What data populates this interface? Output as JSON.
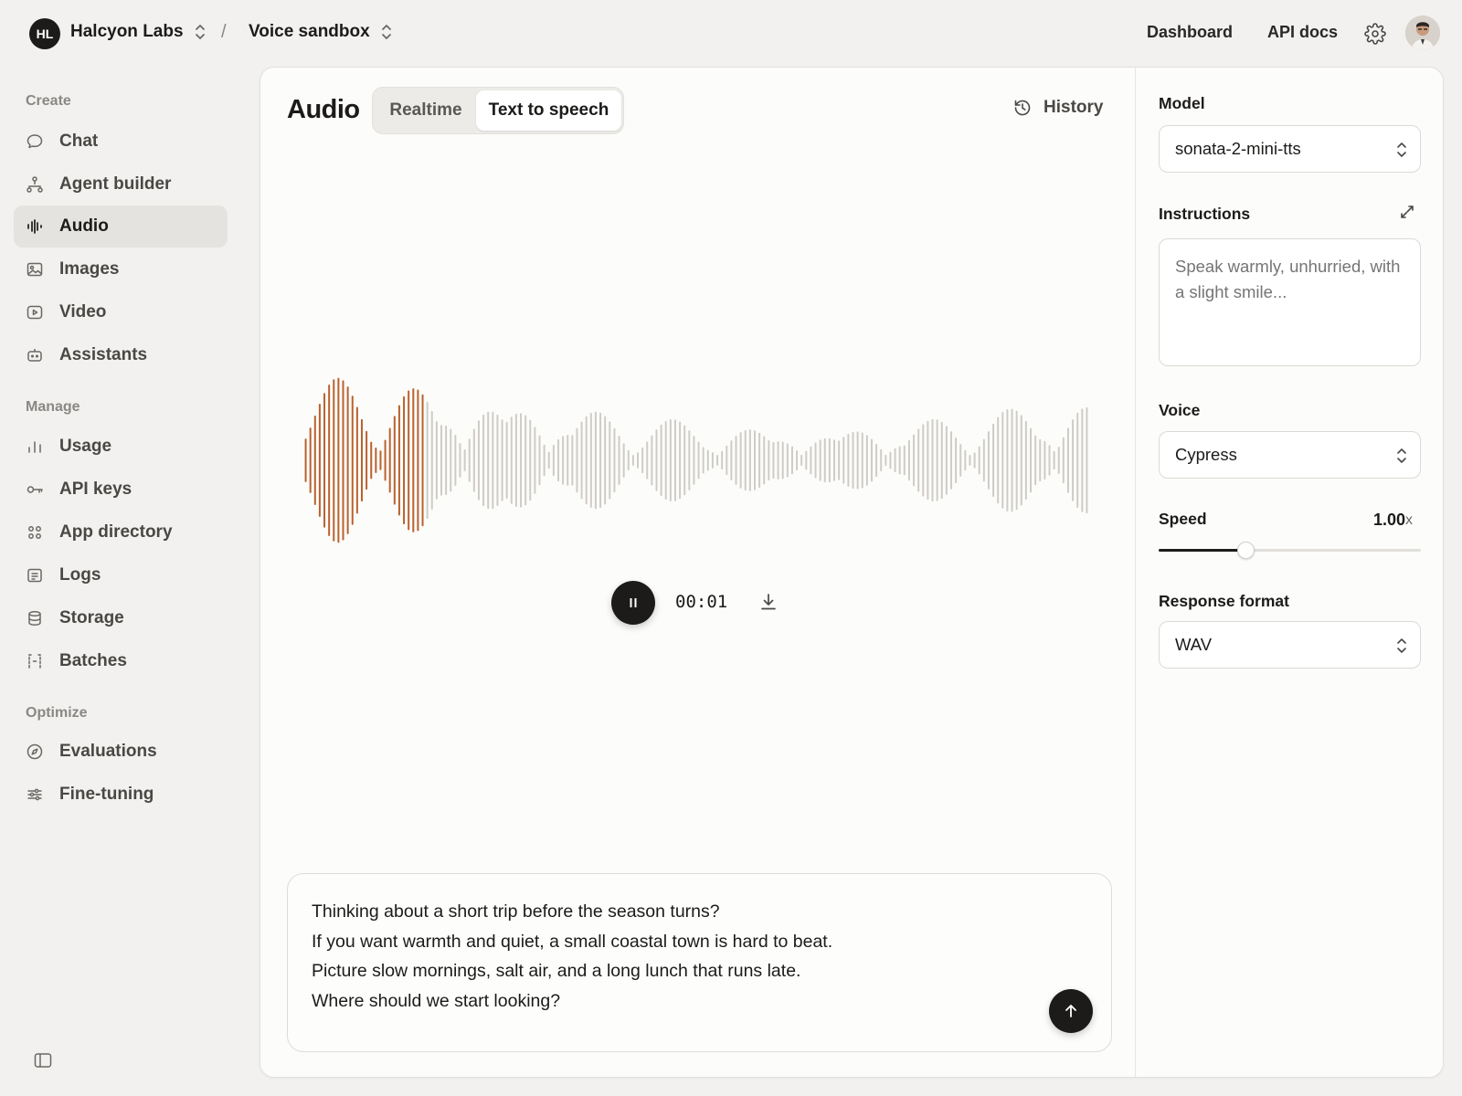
{
  "topbar": {
    "org_initials": "HL",
    "org_name": "Halcyon Labs",
    "project_name": "Voice sandbox",
    "separator": "/",
    "links": [
      "Dashboard",
      "API docs"
    ]
  },
  "sidebar": {
    "sections": [
      {
        "label": "Create",
        "items": [
          {
            "label": "Chat",
            "icon": "chat-bubble-icon"
          },
          {
            "label": "Agent builder",
            "icon": "agent-tree-icon"
          },
          {
            "label": "Audio",
            "icon": "audio-wave-icon",
            "active": true
          },
          {
            "label": "Images",
            "icon": "image-icon"
          },
          {
            "label": "Video",
            "icon": "video-play-icon"
          },
          {
            "label": "Assistants",
            "icon": "robot-icon"
          }
        ]
      },
      {
        "label": "Manage",
        "items": [
          {
            "label": "Usage",
            "icon": "bar-chart-icon"
          },
          {
            "label": "API keys",
            "icon": "key-icon"
          },
          {
            "label": "App directory",
            "icon": "grid-dots-icon"
          },
          {
            "label": "Logs",
            "icon": "log-list-icon"
          },
          {
            "label": "Storage",
            "icon": "database-icon"
          },
          {
            "label": "Batches",
            "icon": "batch-brackets-icon"
          }
        ]
      },
      {
        "label": "Optimize",
        "items": [
          {
            "label": "Evaluations",
            "icon": "compass-icon"
          },
          {
            "label": "Fine-tuning",
            "icon": "sliders-icon"
          }
        ]
      }
    ]
  },
  "main": {
    "title": "Audio",
    "tabs": [
      {
        "label": "Realtime",
        "active": false
      },
      {
        "label": "Text to speech",
        "active": true
      }
    ],
    "history_label": "History",
    "player": {
      "state": "playing",
      "timecode": "00:01",
      "played_fraction": 0.15,
      "played_color": "#b9622e",
      "unplayed_color": "#cfccc7"
    },
    "composer_lines": [
      "Thinking about a short trip before the season turns?",
      "If you want warmth and quiet, a small coastal town is hard to beat.",
      "Picture slow mornings, salt air, and a long lunch that runs late.",
      "Where should we start looking?"
    ]
  },
  "settings": {
    "model_label": "Model",
    "model_value": "sonata-2-mini-tts",
    "instructions_label": "Instructions",
    "instructions_placeholder": "Speak warmly, unhurried, with a slight smile...",
    "voice_label": "Voice",
    "voice_value": "Cypress",
    "speed_label": "Speed",
    "speed_value": "1.00",
    "speed_unit": "x",
    "speed_fraction": 0.33,
    "format_label": "Response format",
    "format_value": "WAV"
  },
  "colors": {
    "accent_played": "#b9622e",
    "background": "#f2f1ef",
    "panel": "#fcfcfa",
    "ink": "#1c1b1a"
  }
}
